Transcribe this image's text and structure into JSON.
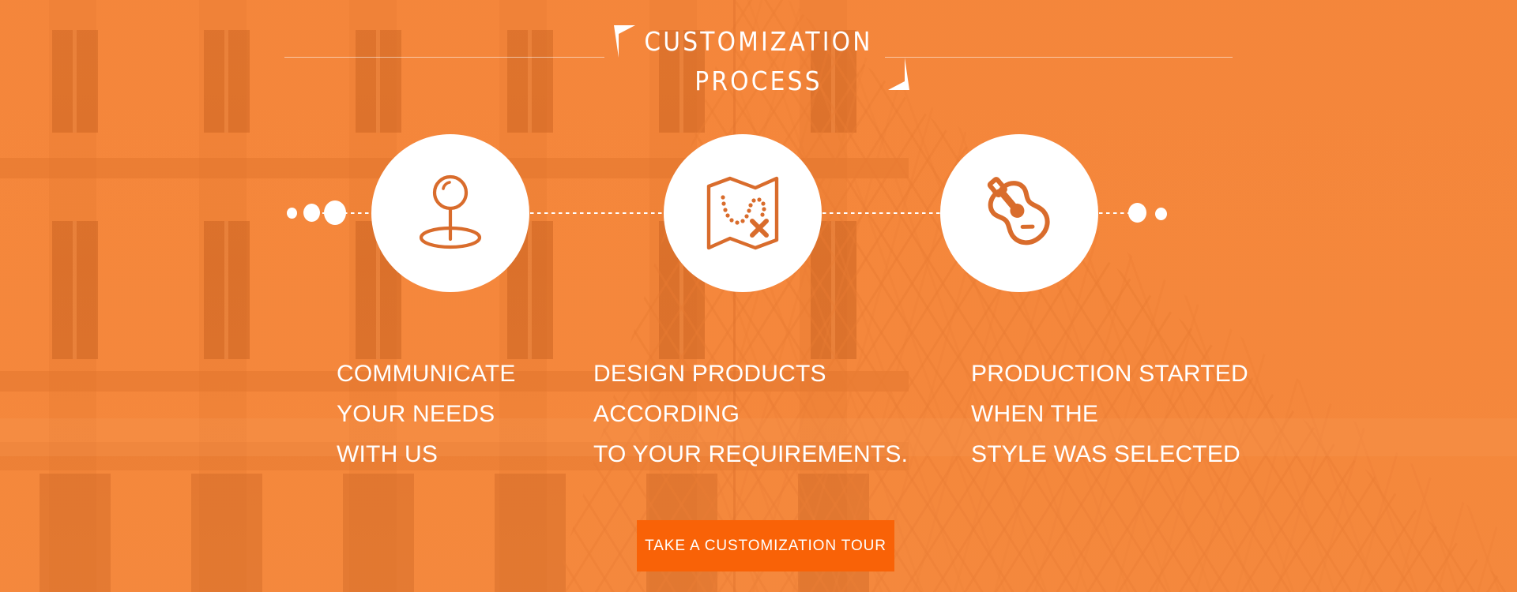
{
  "section": {
    "title_lines": [
      "CUSTOMIZATION",
      "PROCESS"
    ],
    "background_scene": "louvre-palace-and-glass-pyramid"
  },
  "colors": {
    "background_orange": "#F5883C",
    "button_orange": "#F96207",
    "icon_orange": "#D96C2C",
    "circle_white": "#FFFFFF",
    "text_white": "#FFFFFF"
  },
  "steps": [
    {
      "index": "1",
      "icon": "map-pin-marker-icon",
      "caption_lines": [
        "COMMUNICATE",
        "YOUR NEEDS",
        "WITH US"
      ]
    },
    {
      "index": "2",
      "icon": "treasure-map-icon",
      "caption_lines": [
        "DESIGN PRODUCTS",
        "ACCORDING",
        "TO YOUR REQUIREMENTS."
      ]
    },
    {
      "index": "3",
      "icon": "acoustic-guitar-icon",
      "caption_lines": [
        "PRODUCTION STARTED",
        "WHEN THE",
        "STYLE WAS SELECTED"
      ]
    }
  ],
  "cta": {
    "label": "TAKE A CUSTOMIZATION TOUR"
  }
}
